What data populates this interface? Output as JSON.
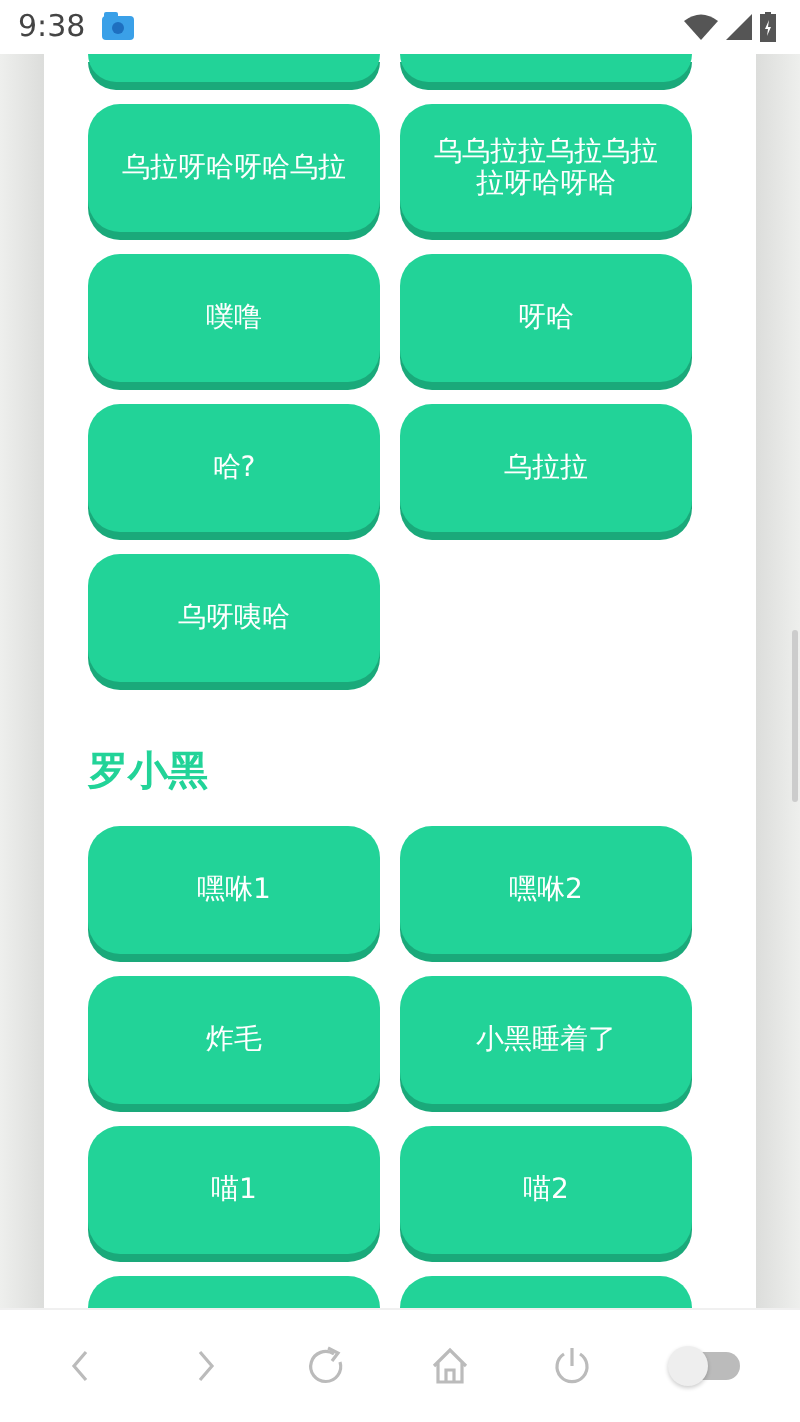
{
  "status_bar": {
    "time": "9:38"
  },
  "sections": [
    {
      "buttons": [
        "乌拉呀哈呀哈乌拉",
        "乌乌拉拉乌拉乌拉拉呀哈呀哈",
        "噗噜",
        "呀哈",
        "哈?",
        "乌拉拉",
        "乌呀咦哈"
      ]
    },
    {
      "title": "罗小黑",
      "buttons": [
        "嘿咻1",
        "嘿咻2",
        "炸毛",
        "小黑睡着了",
        "喵1",
        "喵2"
      ]
    }
  ],
  "toolbar": {
    "toggle": {
      "on": false
    }
  }
}
